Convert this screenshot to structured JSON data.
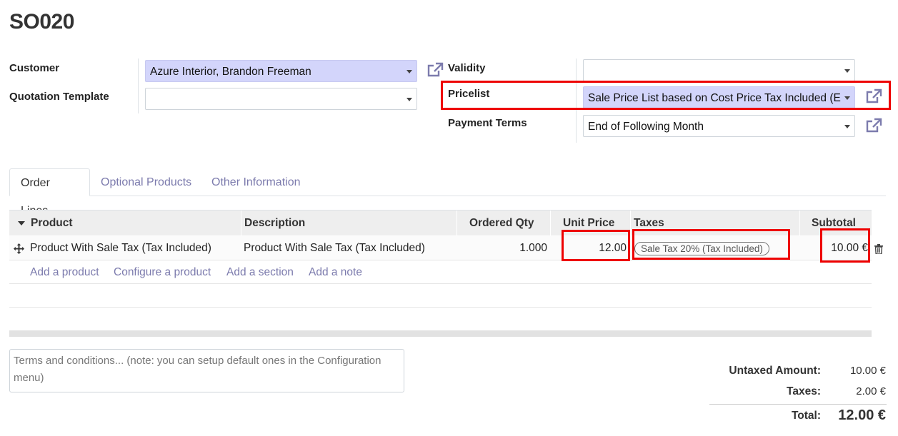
{
  "record": {
    "title": "SO020"
  },
  "form": {
    "customer_label": "Customer",
    "customer_value": "Azure Interior, Brandon Freeman",
    "quotation_template_label": "Quotation Template",
    "quotation_template_value": "",
    "validity_label": "Validity",
    "validity_value": "",
    "pricelist_label": "Pricelist",
    "pricelist_value": "Sale Price List based on Cost Price Tax Included (E",
    "payment_terms_label": "Payment Terms",
    "payment_terms_value": "End of Following Month"
  },
  "tabs": [
    {
      "label": "Order Lines",
      "active": true
    },
    {
      "label": "Optional Products",
      "active": false
    },
    {
      "label": "Other Information",
      "active": false
    }
  ],
  "table": {
    "columns": [
      "Product",
      "Description",
      "Ordered Qty",
      "Unit Price",
      "Taxes",
      "Subtotal"
    ],
    "rows": [
      {
        "product": "Product With Sale Tax (Tax Included)",
        "description": "Product With Sale Tax (Tax Included)",
        "qty": "1.000",
        "unit_price": "12.00",
        "tax": "Sale Tax 20% (Tax Included)",
        "subtotal": "10.00 €"
      }
    ],
    "add_links": [
      "Add a product",
      "Configure a product",
      "Add a section",
      "Add a note"
    ]
  },
  "terms": {
    "placeholder": "Terms and conditions... (note: you can setup default ones in the Configuration menu)"
  },
  "totals": {
    "untaxed_label": "Untaxed Amount:",
    "untaxed_value": "10.00 €",
    "taxes_label": "Taxes:",
    "taxes_value": "2.00 €",
    "total_label": "Total:",
    "total_value": "12.00 €"
  },
  "colors": {
    "accent": "#7c7bad",
    "field_filled_bg": "#d3d5fb",
    "highlight": "#ee0000"
  },
  "icons": {
    "external_link": "external-link-icon",
    "drag_handle": "drag-handle-icon",
    "trash": "trash-icon",
    "dropdown": "caret-down-icon"
  }
}
